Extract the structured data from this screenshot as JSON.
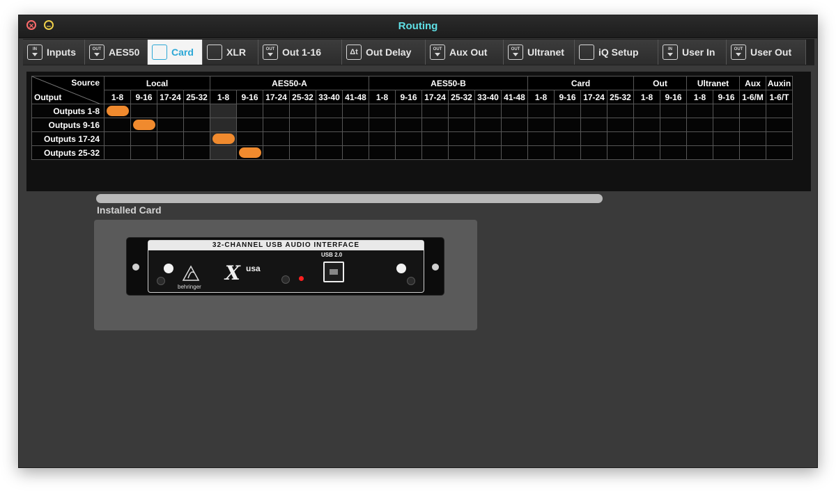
{
  "window": {
    "title": "Routing"
  },
  "tabs": [
    {
      "label": "Inputs",
      "icon": "in-arrow-icon",
      "badge": "IN"
    },
    {
      "label": "AES50",
      "icon": "out-arrow-icon",
      "badge": "OUT"
    },
    {
      "label": "Card",
      "icon": "card-icon",
      "badge": "",
      "active": true
    },
    {
      "label": "XLR",
      "icon": "xlr-connector-icon",
      "badge": ""
    },
    {
      "label": "Out 1-16",
      "icon": "out-arrow-icon",
      "badge": "OUT"
    },
    {
      "label": "Out Delay",
      "icon": "delta-t-icon",
      "badge": "Δt"
    },
    {
      "label": "Aux Out",
      "icon": "out-arrow-icon",
      "badge": "OUT"
    },
    {
      "label": "Ultranet",
      "icon": "out-arrow-icon",
      "badge": "OUT"
    },
    {
      "label": "iQ Setup",
      "icon": "speaker-icon",
      "badge": ""
    },
    {
      "label": "User In",
      "icon": "in-arrow-icon",
      "badge": "IN"
    },
    {
      "label": "User Out",
      "icon": "out-arrow-icon",
      "badge": "OUT"
    }
  ],
  "matrix": {
    "corner_source": "Source",
    "corner_output": "Output",
    "groups": [
      {
        "label": "Local",
        "span": 4
      },
      {
        "label": "AES50-A",
        "span": 6
      },
      {
        "label": "AES50-B",
        "span": 6
      },
      {
        "label": "Card",
        "span": 4
      },
      {
        "label": "Out",
        "span": 2
      },
      {
        "label": "Ultranet",
        "span": 2
      },
      {
        "label": "Aux",
        "span": 1
      },
      {
        "label": "Auxin",
        "span": 1
      }
    ],
    "columns": [
      "1-8",
      "9-16",
      "17-24",
      "25-32",
      "1-8",
      "9-16",
      "17-24",
      "25-32",
      "33-40",
      "41-48",
      "1-8",
      "9-16",
      "17-24",
      "25-32",
      "33-40",
      "41-48",
      "1-8",
      "9-16",
      "17-24",
      "25-32",
      "1-8",
      "9-16",
      "1-8",
      "9-16",
      "1-6/M",
      "1-6/T"
    ],
    "rows": [
      "Outputs 1-8",
      "Outputs 9-16",
      "Outputs 17-24",
      "Outputs 25-32"
    ],
    "assignments": [
      0,
      1,
      4,
      5
    ],
    "dimmed_column": 4,
    "accent_color": "#f08a2e"
  },
  "card": {
    "section_label": "Installed Card",
    "card_title": "32-CHANNEL USB AUDIO INTERFACE",
    "usb_label": "USB 2.0",
    "brand": "behringer",
    "model_logo": "X",
    "model_suffix": "usa"
  },
  "colors": {
    "title": "#5fe0e6",
    "active_tab_text": "#2ba7d6",
    "pill": "#f08a2e"
  }
}
